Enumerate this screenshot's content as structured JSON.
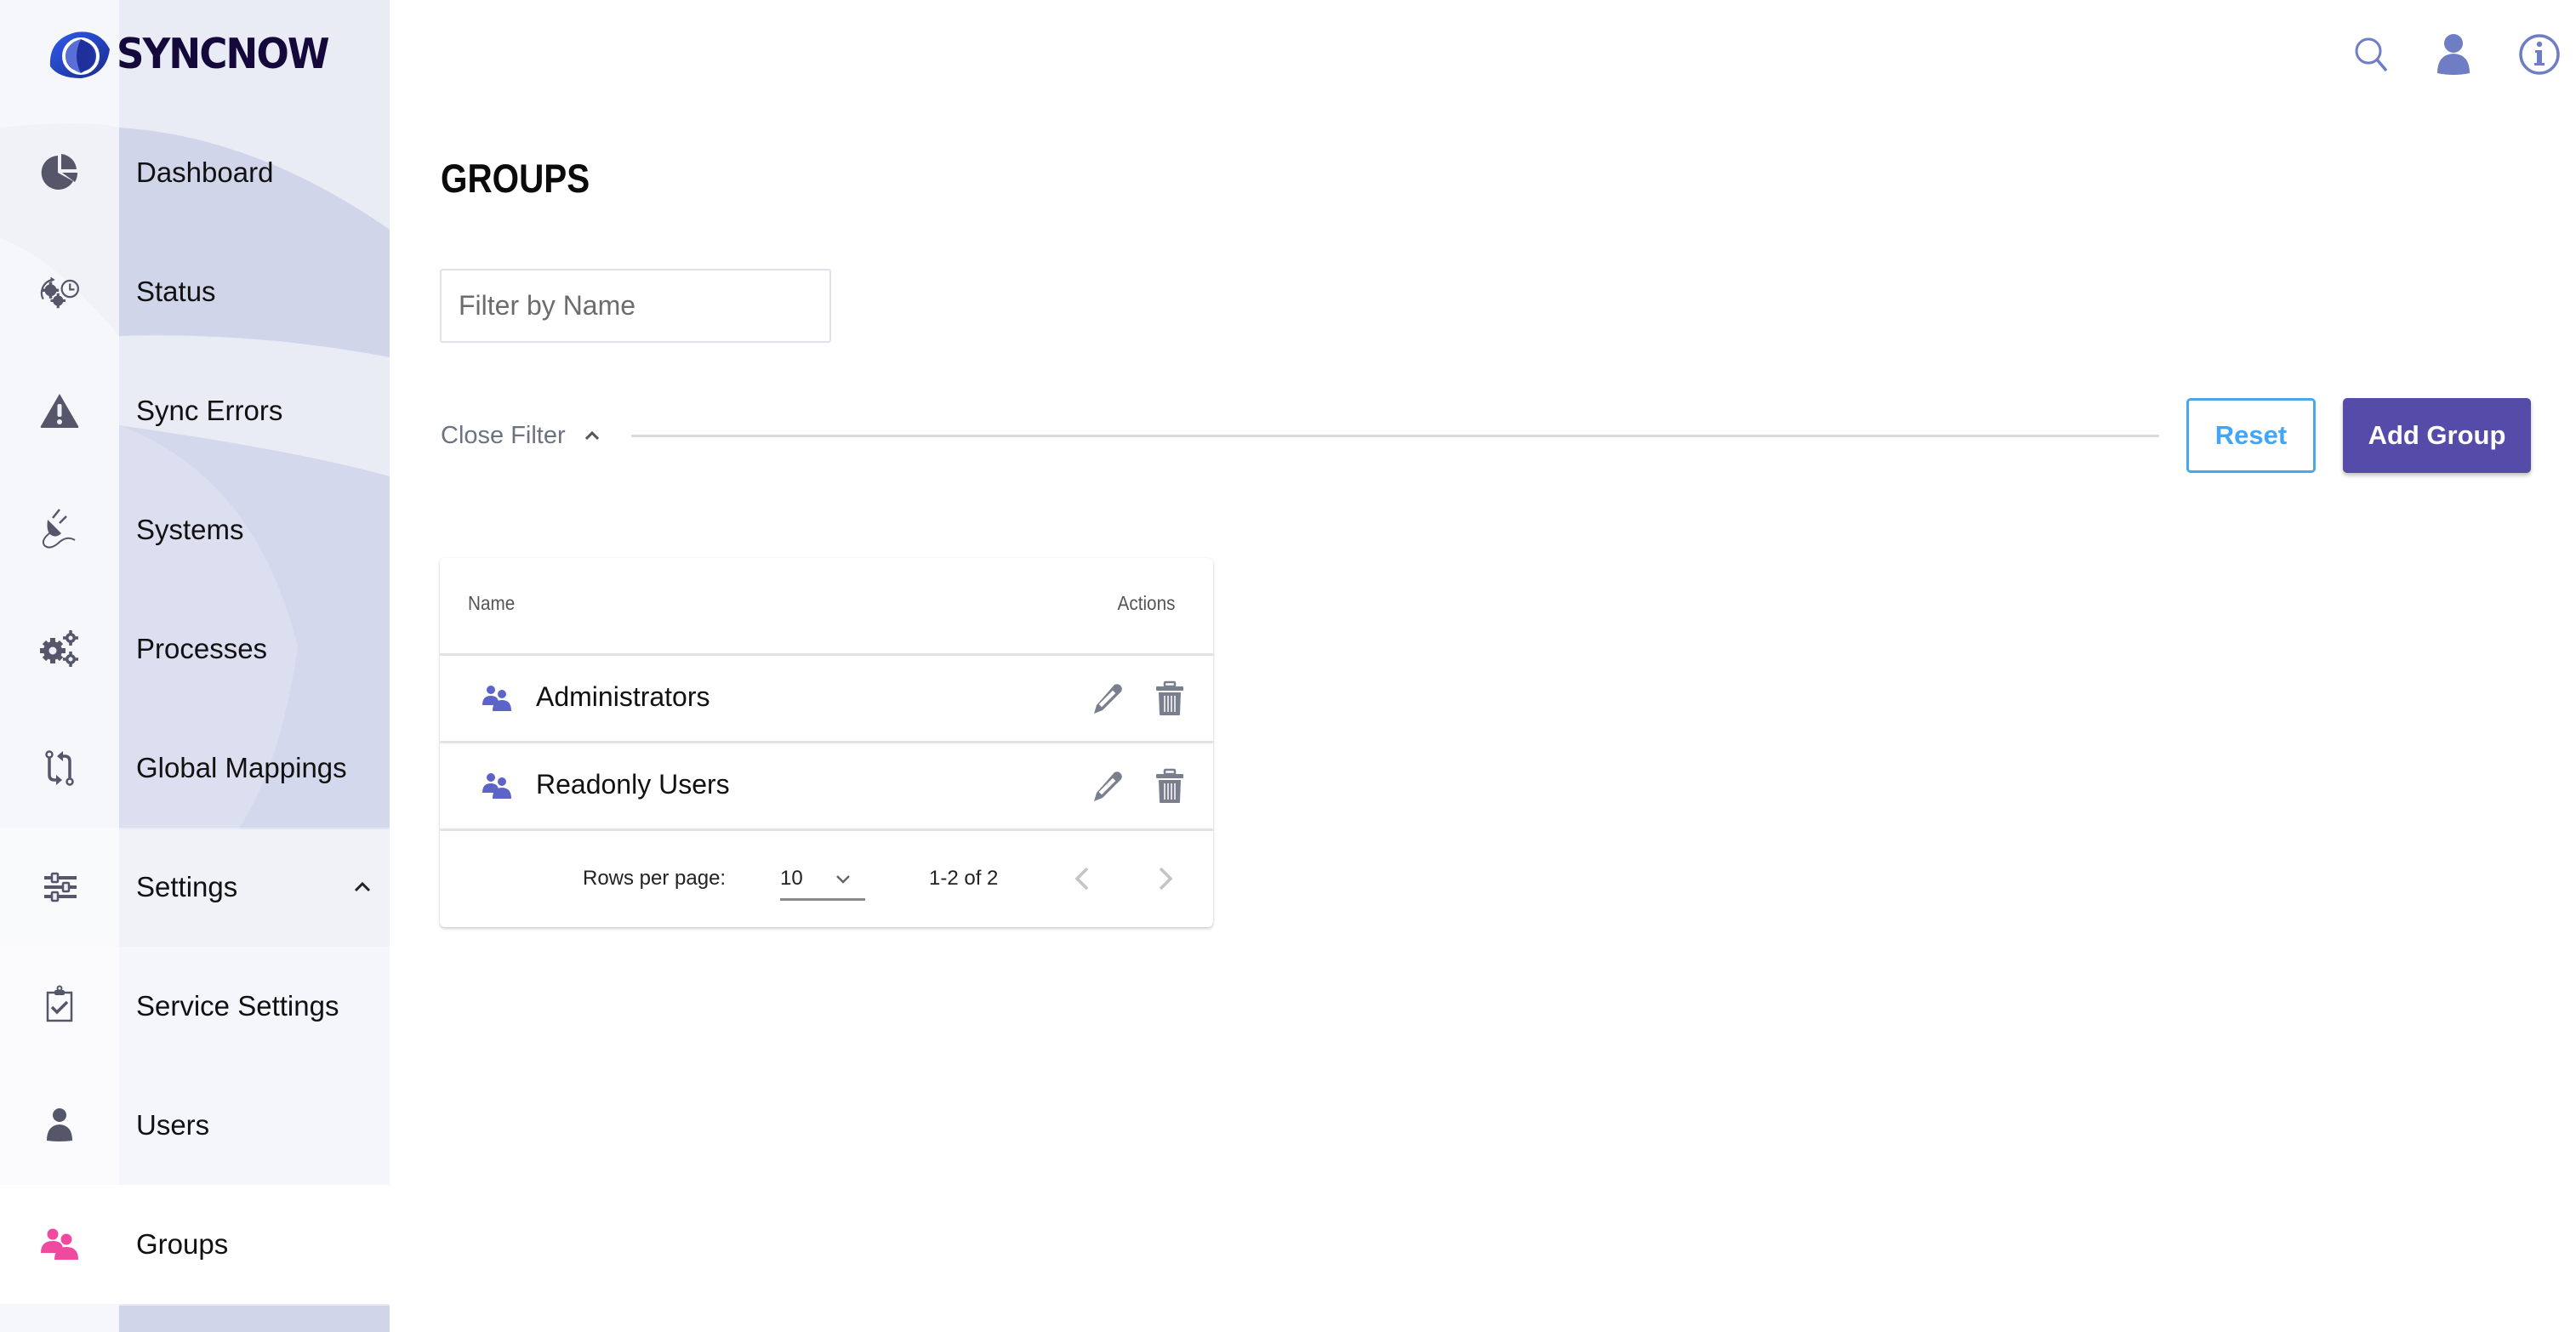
{
  "app": {
    "brand": "SYNCNOW"
  },
  "colors": {
    "primary": "#554ba8",
    "reset_blue": "#42a5f5",
    "active_icon": "#ef4aa0",
    "nav_icon": "#55566a",
    "header_icon": "#6f7ec4",
    "group_icon": "#5c64c7",
    "action_icon": "#7a7f8e"
  },
  "sidebar": {
    "items": [
      {
        "label": "Dashboard",
        "icon": "pie-chart-icon"
      },
      {
        "label": "Status",
        "icon": "gears-clock-icon"
      },
      {
        "label": "Sync Errors",
        "icon": "warning-icon"
      },
      {
        "label": "Systems",
        "icon": "plug-icon"
      },
      {
        "label": "Processes",
        "icon": "cogs-icon"
      },
      {
        "label": "Global Mappings",
        "icon": "sync-arrows-icon"
      },
      {
        "label": "Settings",
        "icon": "sliders-icon",
        "expanded": true
      },
      {
        "label": "Service Settings",
        "icon": "clipboard-check-icon"
      },
      {
        "label": "Users",
        "icon": "user-icon"
      },
      {
        "label": "Groups",
        "icon": "users-icon",
        "active": true
      }
    ]
  },
  "header": {
    "icons": [
      "search-icon",
      "user-icon",
      "info-icon"
    ]
  },
  "main": {
    "title": "GROUPS",
    "filter": {
      "placeholder": "Filter by Name",
      "value": "",
      "toggle_label": "Close Filter"
    },
    "buttons": {
      "reset": "Reset",
      "add": "Add Group"
    },
    "table": {
      "columns": [
        "Name",
        "Actions"
      ],
      "rows": [
        {
          "name": "Administrators"
        },
        {
          "name": "Readonly Users"
        }
      ],
      "pagination": {
        "rows_per_page_label": "Rows per page:",
        "rows_per_page": "10",
        "range": "1-2 of 2"
      }
    }
  }
}
